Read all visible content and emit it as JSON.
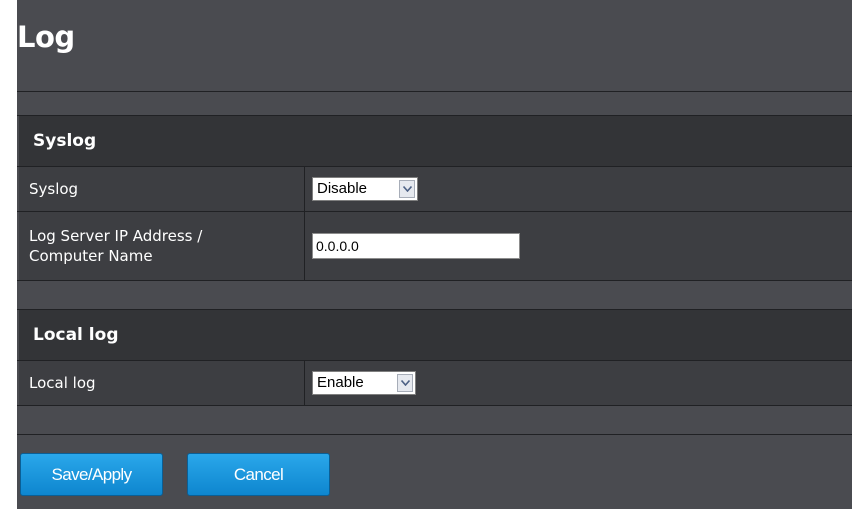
{
  "page": {
    "title": "Log"
  },
  "syslog_section": {
    "heading": "Syslog",
    "syslog_label": "Syslog",
    "syslog_value": "Disable",
    "server_label_line1": "Log Server IP Address /",
    "server_label_line2": "Computer Name",
    "server_value": "0.0.0.0"
  },
  "local_section": {
    "heading": "Local log",
    "local_label": "Local log",
    "local_value": "Enable"
  },
  "buttons": {
    "save": "Save/Apply",
    "cancel": "Cancel"
  },
  "icons": {
    "dropdown": "chevron-down-icon"
  },
  "colors": {
    "background": "#4a4b50",
    "section_header": "#333437",
    "button": "#1a97df"
  }
}
